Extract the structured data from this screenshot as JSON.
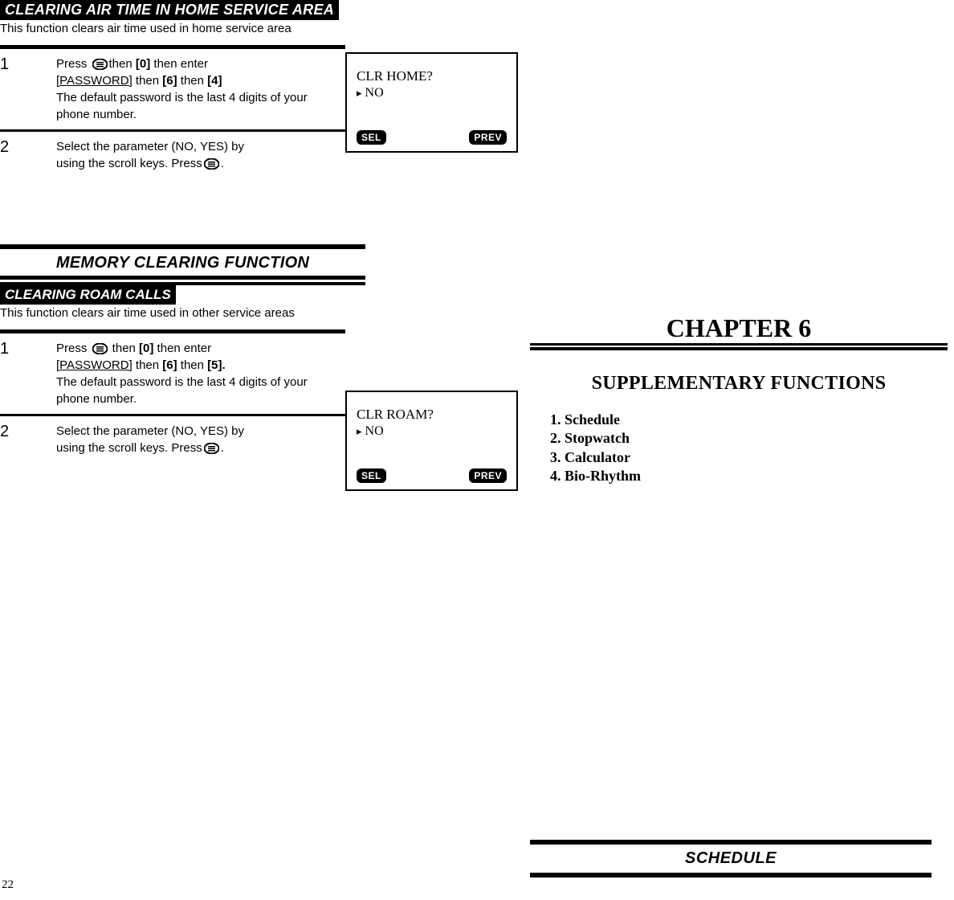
{
  "left": {
    "section1": {
      "title": "CLEARING AIR TIME IN HOME SERVICE AREA",
      "description": "This function clears air time used in home service area",
      "step1": {
        "num": "1",
        "press": "Press ",
        "after_icon": "then ",
        "zero": "[0]",
        "then_enter": " then enter",
        "pw_line": "[PASSWORD]",
        "then": " then ",
        "six": "[6]",
        "then2": " then ",
        "four": "[4]",
        "default_pw": "The default password is the last 4 digits of your phone number."
      },
      "step2": {
        "num": "2",
        "text_a": "Select the parameter (NO, YES) by",
        "text_b": "using the scroll keys. Press",
        "text_c": "."
      },
      "screen": {
        "title": "CLR HOME?",
        "option": "NO",
        "sel": "SEL",
        "prev": "PREV"
      }
    },
    "mid": {
      "title": "MEMORY CLEARING FUNCTION",
      "subtitle": "CLEARING ROAM CALLS"
    },
    "section2": {
      "description": "This function clears air time used in other service areas",
      "step1": {
        "num": "1",
        "press": "Press ",
        "after_icon": " then ",
        "zero": "[0]",
        "then_enter": " then enter",
        "pw_line": "[PASSWORD]",
        "then": " then ",
        "six": "[6]",
        "then2": " then ",
        "five": "[5].",
        "default_pw": "The default password is the last 4 digits of your phone number."
      },
      "step2": {
        "num": "2",
        "text_a": "Select the parameter (NO, YES) by",
        "text_b": "using the scroll keys. Press",
        "text_c": "."
      },
      "screen": {
        "title": "CLR ROAM?",
        "option": "NO",
        "sel": "SEL",
        "prev": "PREV"
      }
    }
  },
  "right": {
    "chapter": "CHAPTER 6",
    "supp_title": "SUPPLEMENTARY FUNCTIONS",
    "list": {
      "i1": "1. Schedule",
      "i2": "2. Stopwatch",
      "i3": "3. Calculator",
      "i4": "4. Bio-Rhythm"
    },
    "schedule": "SCHEDULE"
  },
  "page_num": "22"
}
